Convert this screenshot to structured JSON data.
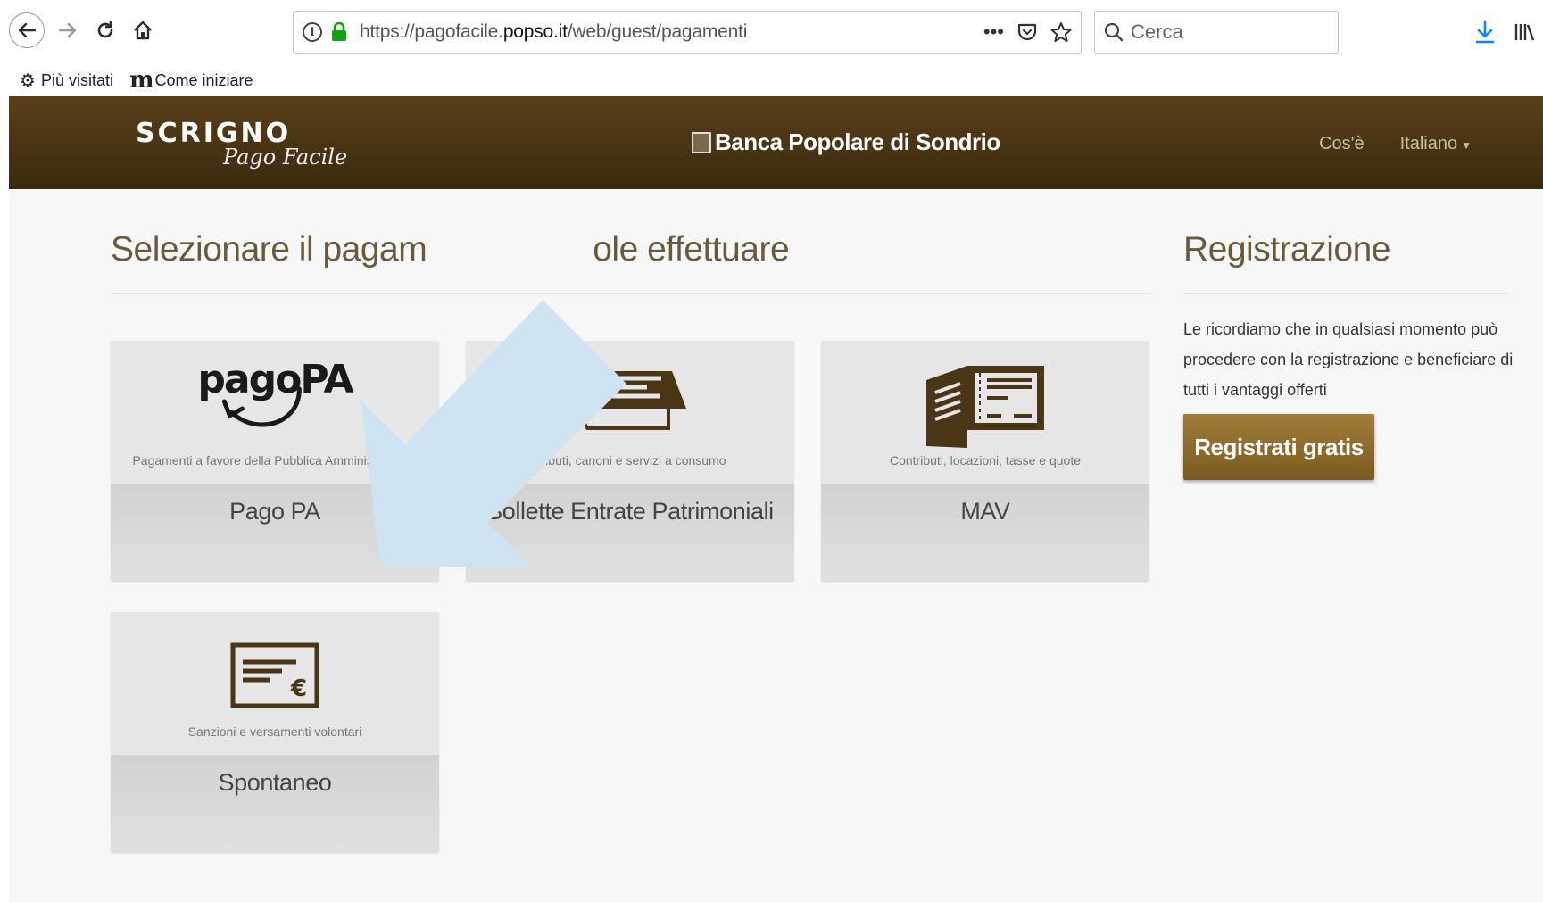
{
  "browser": {
    "url_prefix": "https://pagofacile.",
    "url_host": "popso.it",
    "url_path": "/web/guest/pagamenti",
    "search_placeholder": "Cerca",
    "more_label": "•••",
    "bookmarks": [
      {
        "label": "Più visitati"
      },
      {
        "label": "Come iniziare"
      }
    ]
  },
  "header": {
    "logo_main": "SCRIGNO",
    "logo_sub": "Pago Facile",
    "bank_name": "Banca Popolare di Sondrio",
    "nav": [
      {
        "label": "Cos'è"
      },
      {
        "label": "Italiano"
      }
    ]
  },
  "main": {
    "title_left": "Selezionare il pagam",
    "title_right": "ole effettuare",
    "cards": [
      {
        "logo": "pagoPA",
        "description": "Pagamenti a favore della Pubblica Amministrazione",
        "label": "Pago PA",
        "icon": "pagopa-icon"
      },
      {
        "description": "Tributi, canoni e servizi a consumo",
        "label": "Bollette Entrate Patrimoniali",
        "icon": "bills-icon"
      },
      {
        "description": "Contributi, locazioni, tasse e quote",
        "label": "MAV",
        "icon": "booklet-icon"
      },
      {
        "description": "Sanzioni e versamenti volontari",
        "label": "Spontaneo",
        "icon": "euro-slip-icon"
      }
    ]
  },
  "registration": {
    "title": "Registrazione",
    "text": "Le ricordiamo che in qualsiasi momento può procedere con la registrazione e beneficiare di tutti i vantaggi offerti",
    "button_label": "Registrati gratis"
  },
  "colors": {
    "header_bg": "#4a3514",
    "accent_gold": "#8f6c2c",
    "arrow_fill": "#cfe4f3"
  }
}
